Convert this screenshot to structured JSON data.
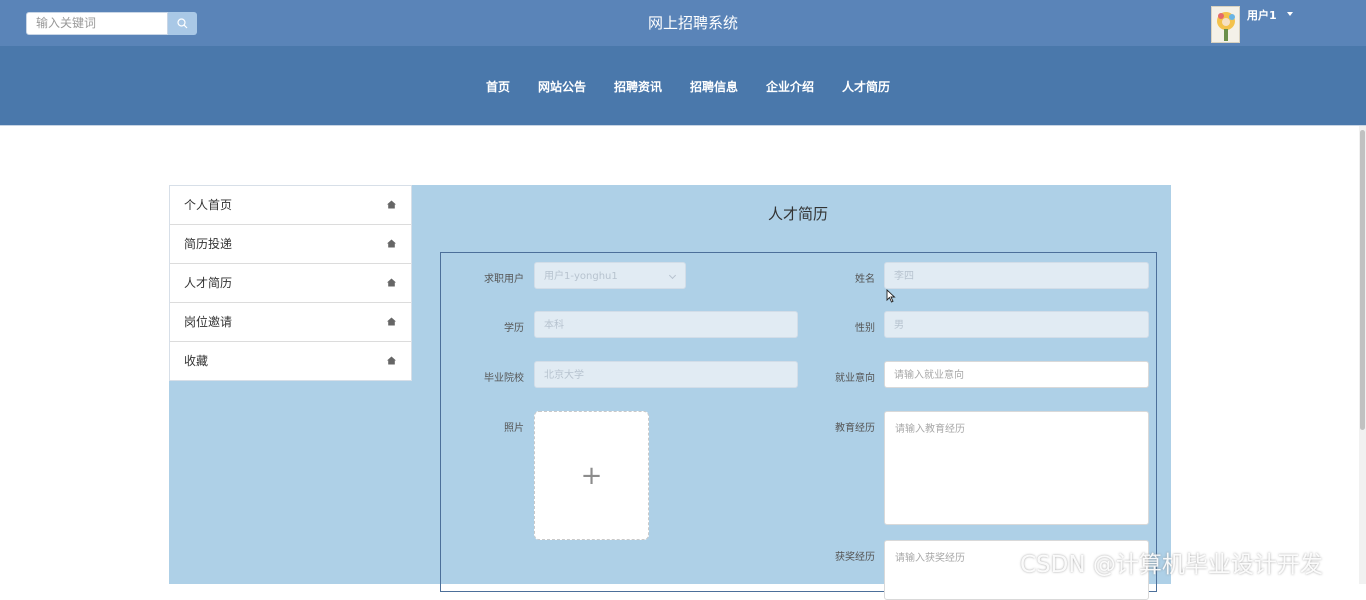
{
  "header": {
    "search_placeholder": "输入关键词",
    "site_title": "网上招聘系统",
    "user_name": "用户1"
  },
  "nav": [
    "首页",
    "网站公告",
    "招聘资讯",
    "招聘信息",
    "企业介绍",
    "人才简历"
  ],
  "sidebar": [
    "个人首页",
    "简历投递",
    "人才简历",
    "岗位邀请",
    "收藏"
  ],
  "panel": {
    "title": "人才简历",
    "fields": {
      "applicant_label": "求职用户",
      "applicant_value": "用户1-yonghu1",
      "name_label": "姓名",
      "name_value": "李四",
      "education_label": "学历",
      "education_value": "本科",
      "gender_label": "性别",
      "gender_value": "男",
      "school_label": "毕业院校",
      "school_value": "北京大学",
      "intention_label": "就业意向",
      "intention_placeholder": "请输入就业意向",
      "photo_label": "照片",
      "edu_exp_label": "教育经历",
      "edu_exp_placeholder": "请输入教育经历",
      "award_label": "获奖经历",
      "award_placeholder": "请输入获奖经历"
    }
  },
  "watermark": "CSDN @计算机毕业设计开发",
  "colors": {
    "topbar": "#5a84b8",
    "navbar": "#4a78ab",
    "panel": "#aed0e7"
  }
}
